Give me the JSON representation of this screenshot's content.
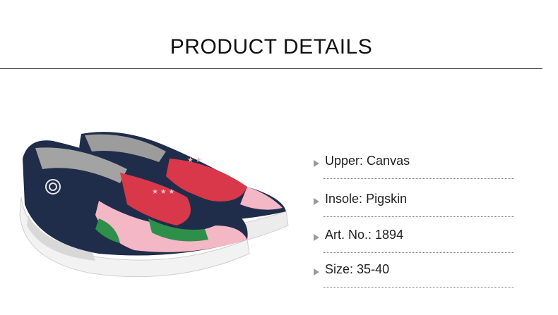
{
  "header": {
    "title": "PRODUCT DETAILS"
  },
  "product_image": {
    "icon": "shoe-image"
  },
  "specs": [
    {
      "label": "Upper:",
      "value": "Canvas"
    },
    {
      "label": "Insole:",
      "value": "Pigskin"
    },
    {
      "label": "Art. No.:",
      "value": "1894"
    },
    {
      "label": "Size:",
      "value": "35-40"
    }
  ],
  "colors": {
    "navy": "#1f2d4a",
    "red": "#d9374a",
    "pink": "#f4b7c6",
    "green": "#2e8f4a",
    "sole": "#f2f2f2"
  }
}
